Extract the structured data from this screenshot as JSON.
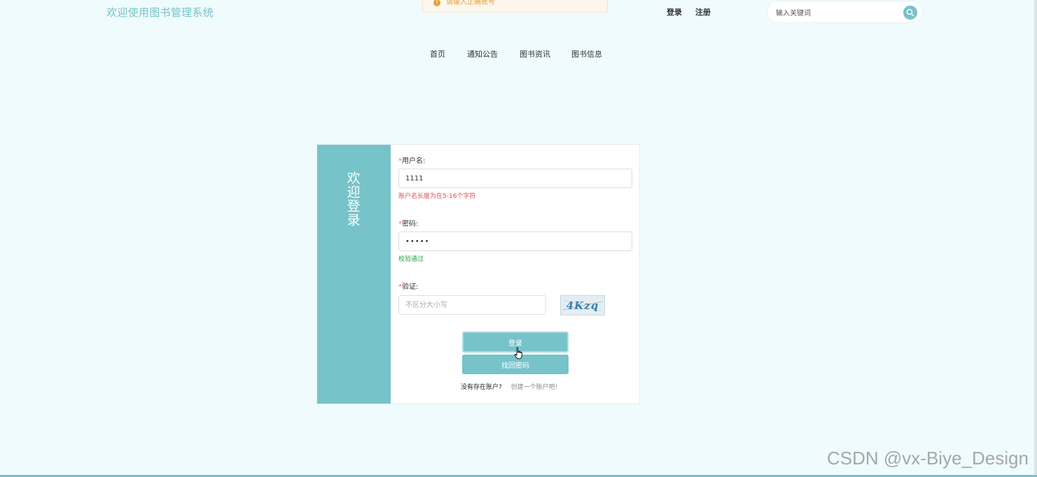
{
  "header": {
    "site_title": "欢迎使用图书管理系统",
    "toast_text": "请输入正确账号",
    "links": {
      "login": "登录",
      "register": "注册"
    },
    "search": {
      "placeholder": "输入关键词",
      "icon": "search-icon"
    }
  },
  "nav": {
    "items": [
      "首页",
      "通知公告",
      "图书资讯",
      "图书信息"
    ]
  },
  "login_form": {
    "side_title": "欢迎登录",
    "required_mark": "*",
    "username": {
      "label": "用户名:",
      "value": "1111",
      "message": "账户名长度为在5-16个字符"
    },
    "password": {
      "label": "密码:",
      "value": "•••••",
      "message": "校验通过"
    },
    "captcha": {
      "label": "验证:",
      "placeholder": "不区分大小写",
      "image_text": "4Kzq"
    },
    "login_button": "登录",
    "forgot_button": "找回密码",
    "no_account_text": "没有存在账户?",
    "create_account_link": "创建一个账户吧!"
  },
  "watermark": "CSDN @vx-Biye_Design",
  "colors": {
    "accent": "#76c3c9",
    "background": "#effbfd",
    "error": "#e04f4f",
    "success": "#27a04b",
    "warning": "#e6a23c"
  }
}
